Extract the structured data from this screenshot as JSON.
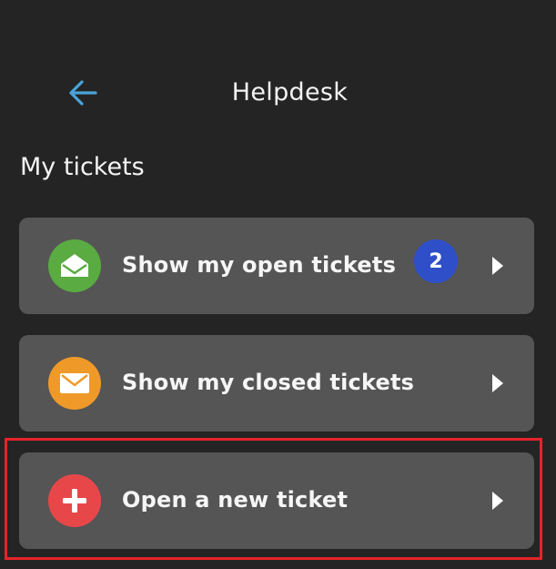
{
  "header": {
    "title": "Helpdesk",
    "back_icon": "arrow-left-icon",
    "back_color": "#4aa3d9"
  },
  "section": {
    "title": "My tickets"
  },
  "cards": [
    {
      "label": "Show my open tickets",
      "icon": "open-envelope-icon",
      "icon_bg": "#5aab41",
      "badge": "2",
      "badge_bg": "#2f4fc9"
    },
    {
      "label": "Show my closed tickets",
      "icon": "closed-envelope-icon",
      "icon_bg": "#ef9a28"
    },
    {
      "label": "Open a new ticket",
      "icon": "plus-icon",
      "icon_bg": "#e8474a"
    }
  ],
  "colors": {
    "background": "#242424",
    "card": "#555555",
    "highlight": "#e5232b"
  }
}
